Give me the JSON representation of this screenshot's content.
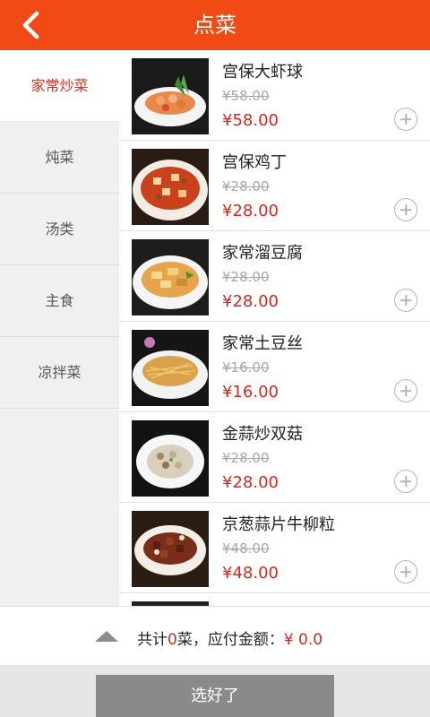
{
  "header": {
    "title": "点菜",
    "back_icon": "chevron-left-icon"
  },
  "categories": [
    {
      "label": "家常炒菜",
      "active": true
    },
    {
      "label": "炖菜",
      "active": false
    },
    {
      "label": "汤类",
      "active": false
    },
    {
      "label": "主食",
      "active": false
    },
    {
      "label": "凉拌菜",
      "active": false
    }
  ],
  "dishes": [
    {
      "name": "宫保大虾球",
      "old_price": "¥58.00",
      "price": "¥58.00",
      "add_icon": "plus-circle-icon"
    },
    {
      "name": "宫保鸡丁",
      "old_price": "¥28.00",
      "price": "¥28.00",
      "add_icon": "plus-circle-icon"
    },
    {
      "name": "家常溜豆腐",
      "old_price": "¥28.00",
      "price": "¥28.00",
      "add_icon": "plus-circle-icon"
    },
    {
      "name": "家常土豆丝",
      "old_price": "¥16.00",
      "price": "¥16.00",
      "add_icon": "plus-circle-icon"
    },
    {
      "name": "金蒜炒双菇",
      "old_price": "¥28.00",
      "price": "¥28.00",
      "add_icon": "plus-circle-icon"
    },
    {
      "name": "京葱蒜片牛柳粒",
      "old_price": "¥48.00",
      "price": "¥48.00",
      "add_icon": "plus-circle-icon"
    }
  ],
  "summary": {
    "prefix": "共计",
    "count": "0",
    "middle": "菜，应付金额：",
    "amount": "¥ 0.0",
    "expand_icon": "triangle-up-icon"
  },
  "footer": {
    "confirm_label": "选好了"
  },
  "colors": {
    "brand": "#f24a15",
    "price": "#d8261b",
    "active_category": "#e0301e"
  }
}
